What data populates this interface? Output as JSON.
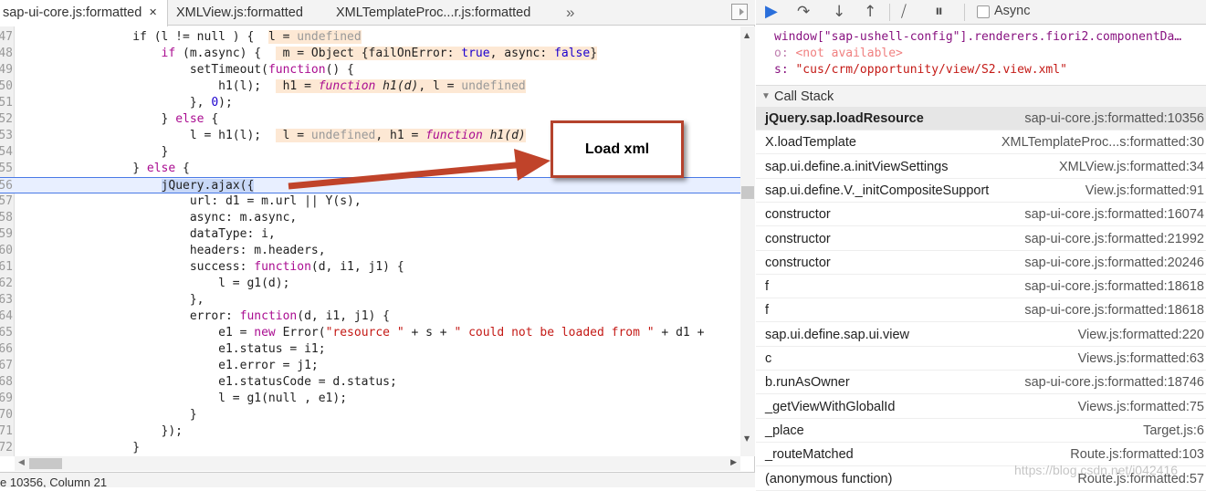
{
  "tabs": [
    {
      "label": "sap-ui-core.js:formatted",
      "close": "×"
    },
    {
      "label": "XMLView.js:formatted"
    },
    {
      "label": "XMLTemplateProc...r.js:formatted"
    }
  ],
  "tabs_overflow": "»",
  "code_lines": [
    {
      "n": "47",
      "s": [
        [
          "",
          "                if (l != null ) {  "
        ],
        [
          "inl",
          "l = "
        ],
        [
          "inl gray",
          "undefined"
        ]
      ]
    },
    {
      "n": "48",
      "s": [
        [
          "",
          "                    "
        ],
        [
          "kw",
          "if"
        ],
        [
          "",
          " (m.async) {  "
        ],
        [
          "inl",
          " m = Object {failOnError: "
        ],
        [
          "inl num",
          "true"
        ],
        [
          "inl",
          ", async: "
        ],
        [
          "inl num",
          "false"
        ],
        [
          "inl",
          "}"
        ]
      ]
    },
    {
      "n": "49",
      "s": [
        [
          "",
          "                        setTimeout("
        ],
        [
          "kw",
          "function"
        ],
        [
          "",
          "() {"
        ]
      ]
    },
    {
      "n": "50",
      "s": [
        [
          "",
          "                            h1(l);  "
        ],
        [
          "inl",
          " h1 = "
        ],
        [
          "inl fn",
          "function"
        ],
        [
          "inl it",
          " h1(d)"
        ],
        [
          "inl",
          ", l = "
        ],
        [
          "inl gray",
          "undefined"
        ]
      ]
    },
    {
      "n": "51",
      "s": [
        [
          "",
          "                        }, "
        ],
        [
          "num",
          "0"
        ],
        [
          "",
          ");"
        ]
      ]
    },
    {
      "n": "52",
      "s": [
        [
          "",
          "                    } "
        ],
        [
          "kw",
          "else"
        ],
        [
          "",
          " {"
        ]
      ]
    },
    {
      "n": "53",
      "s": [
        [
          "",
          "                        l = h1(l);  "
        ],
        [
          "inl",
          " l = "
        ],
        [
          "inl gray",
          "undefined"
        ],
        [
          "inl",
          ", h1 = "
        ],
        [
          "inl fn",
          "function"
        ],
        [
          "inl it",
          " h1(d)"
        ]
      ]
    },
    {
      "n": "54",
      "s": [
        [
          "",
          "                    }"
        ]
      ]
    },
    {
      "n": "55",
      "s": [
        [
          "",
          "                } "
        ],
        [
          "kw",
          "else"
        ],
        [
          "",
          " {"
        ]
      ]
    },
    {
      "n": "56",
      "s": [
        [
          "",
          "                    "
        ],
        [
          "sel",
          "jQuery.ajax({"
        ]
      ],
      "hl": true
    },
    {
      "n": "57",
      "s": [
        [
          "",
          "                        url: d1 = m.url || Y(s),"
        ]
      ]
    },
    {
      "n": "58",
      "s": [
        [
          "",
          "                        async: m.async,"
        ]
      ]
    },
    {
      "n": "59",
      "s": [
        [
          "",
          "                        dataType: i,"
        ]
      ]
    },
    {
      "n": "60",
      "s": [
        [
          "",
          "                        headers: m.headers,"
        ]
      ]
    },
    {
      "n": "61",
      "s": [
        [
          "",
          "                        success: "
        ],
        [
          "kw",
          "function"
        ],
        [
          "",
          "(d, i1, j1) {"
        ]
      ]
    },
    {
      "n": "62",
      "s": [
        [
          "",
          "                            l = g1(d);"
        ]
      ]
    },
    {
      "n": "63",
      "s": [
        [
          "",
          "                        },"
        ]
      ]
    },
    {
      "n": "64",
      "s": [
        [
          "",
          "                        error: "
        ],
        [
          "kw",
          "function"
        ],
        [
          "",
          "(d, i1, j1) {"
        ]
      ]
    },
    {
      "n": "65",
      "s": [
        [
          "",
          "                            e1 = "
        ],
        [
          "kw",
          "new"
        ],
        [
          "",
          " Error("
        ],
        [
          "str",
          "\"resource \""
        ],
        [
          "",
          " + s + "
        ],
        [
          "str",
          "\" could not be loaded from \""
        ],
        [
          "",
          " + d1 + "
        ]
      ]
    },
    {
      "n": "66",
      "s": [
        [
          "",
          "                            e1.status = i1;"
        ]
      ]
    },
    {
      "n": "67",
      "s": [
        [
          "",
          "                            e1.error = j1;"
        ]
      ]
    },
    {
      "n": "68",
      "s": [
        [
          "",
          "                            e1.statusCode = d.status;"
        ]
      ]
    },
    {
      "n": "69",
      "s": [
        [
          "",
          "                            l = g1(null , e1);"
        ]
      ]
    },
    {
      "n": "70",
      "s": [
        [
          "",
          "                        }"
        ]
      ]
    },
    {
      "n": "71",
      "s": [
        [
          "",
          "                    });"
        ]
      ]
    },
    {
      "n": "72",
      "s": [
        [
          "",
          "                }"
        ]
      ]
    },
    {
      "n": "73",
      "s": [
        [
          "",
          ""
        ]
      ]
    }
  ],
  "status": "e 10356, Column 21",
  "callout": "Load xml",
  "toolbar": {
    "async_label": "Async",
    "async_checked": false
  },
  "scope": {
    "line1": "window[\"sap-ushell-config\"].renderers.fiori2.componentDa…",
    "o_key": "o:",
    "o_val": "<not available>",
    "s_key": "s:",
    "s_val": "\"cus/crm/opportunity/view/S2.view.xml\""
  },
  "callstack": {
    "title": "Call Stack",
    "frames": [
      {
        "fn": "jQuery.sap.loadResource",
        "loc": "sap-ui-core.js:formatted:10356"
      },
      {
        "fn": "X.loadTemplate",
        "loc": "XMLTemplateProc...s:formatted:30"
      },
      {
        "fn": "sap.ui.define.a.initViewSettings",
        "loc": "XMLView.js:formatted:34"
      },
      {
        "fn": "sap.ui.define.V._initCompositeSupport",
        "loc": "View.js:formatted:91"
      },
      {
        "fn": "constructor",
        "loc": "sap-ui-core.js:formatted:16074"
      },
      {
        "fn": "constructor",
        "loc": "sap-ui-core.js:formatted:21992"
      },
      {
        "fn": "constructor",
        "loc": "sap-ui-core.js:formatted:20246"
      },
      {
        "fn": "f",
        "loc": "sap-ui-core.js:formatted:18618"
      },
      {
        "fn": "f",
        "loc": "sap-ui-core.js:formatted:18618"
      },
      {
        "fn": "sap.ui.define.sap.ui.view",
        "loc": "View.js:formatted:220"
      },
      {
        "fn": "c",
        "loc": "Views.js:formatted:63"
      },
      {
        "fn": "b.runAsOwner",
        "loc": "sap-ui-core.js:formatted:18746"
      },
      {
        "fn": "_getViewWithGlobalId",
        "loc": "Views.js:formatted:75"
      },
      {
        "fn": "_place",
        "loc": "Target.js:6"
      },
      {
        "fn": "_routeMatched",
        "loc": "Route.js:formatted:103"
      },
      {
        "fn": "(anonymous function)",
        "loc": "Route.js:formatted:57"
      }
    ]
  },
  "watermark": "https://blog.csdn.net/i042416",
  "colors": {
    "accent": "#4a7ae6",
    "callout_border": "#b5432d",
    "arrow": "#c0432a"
  }
}
